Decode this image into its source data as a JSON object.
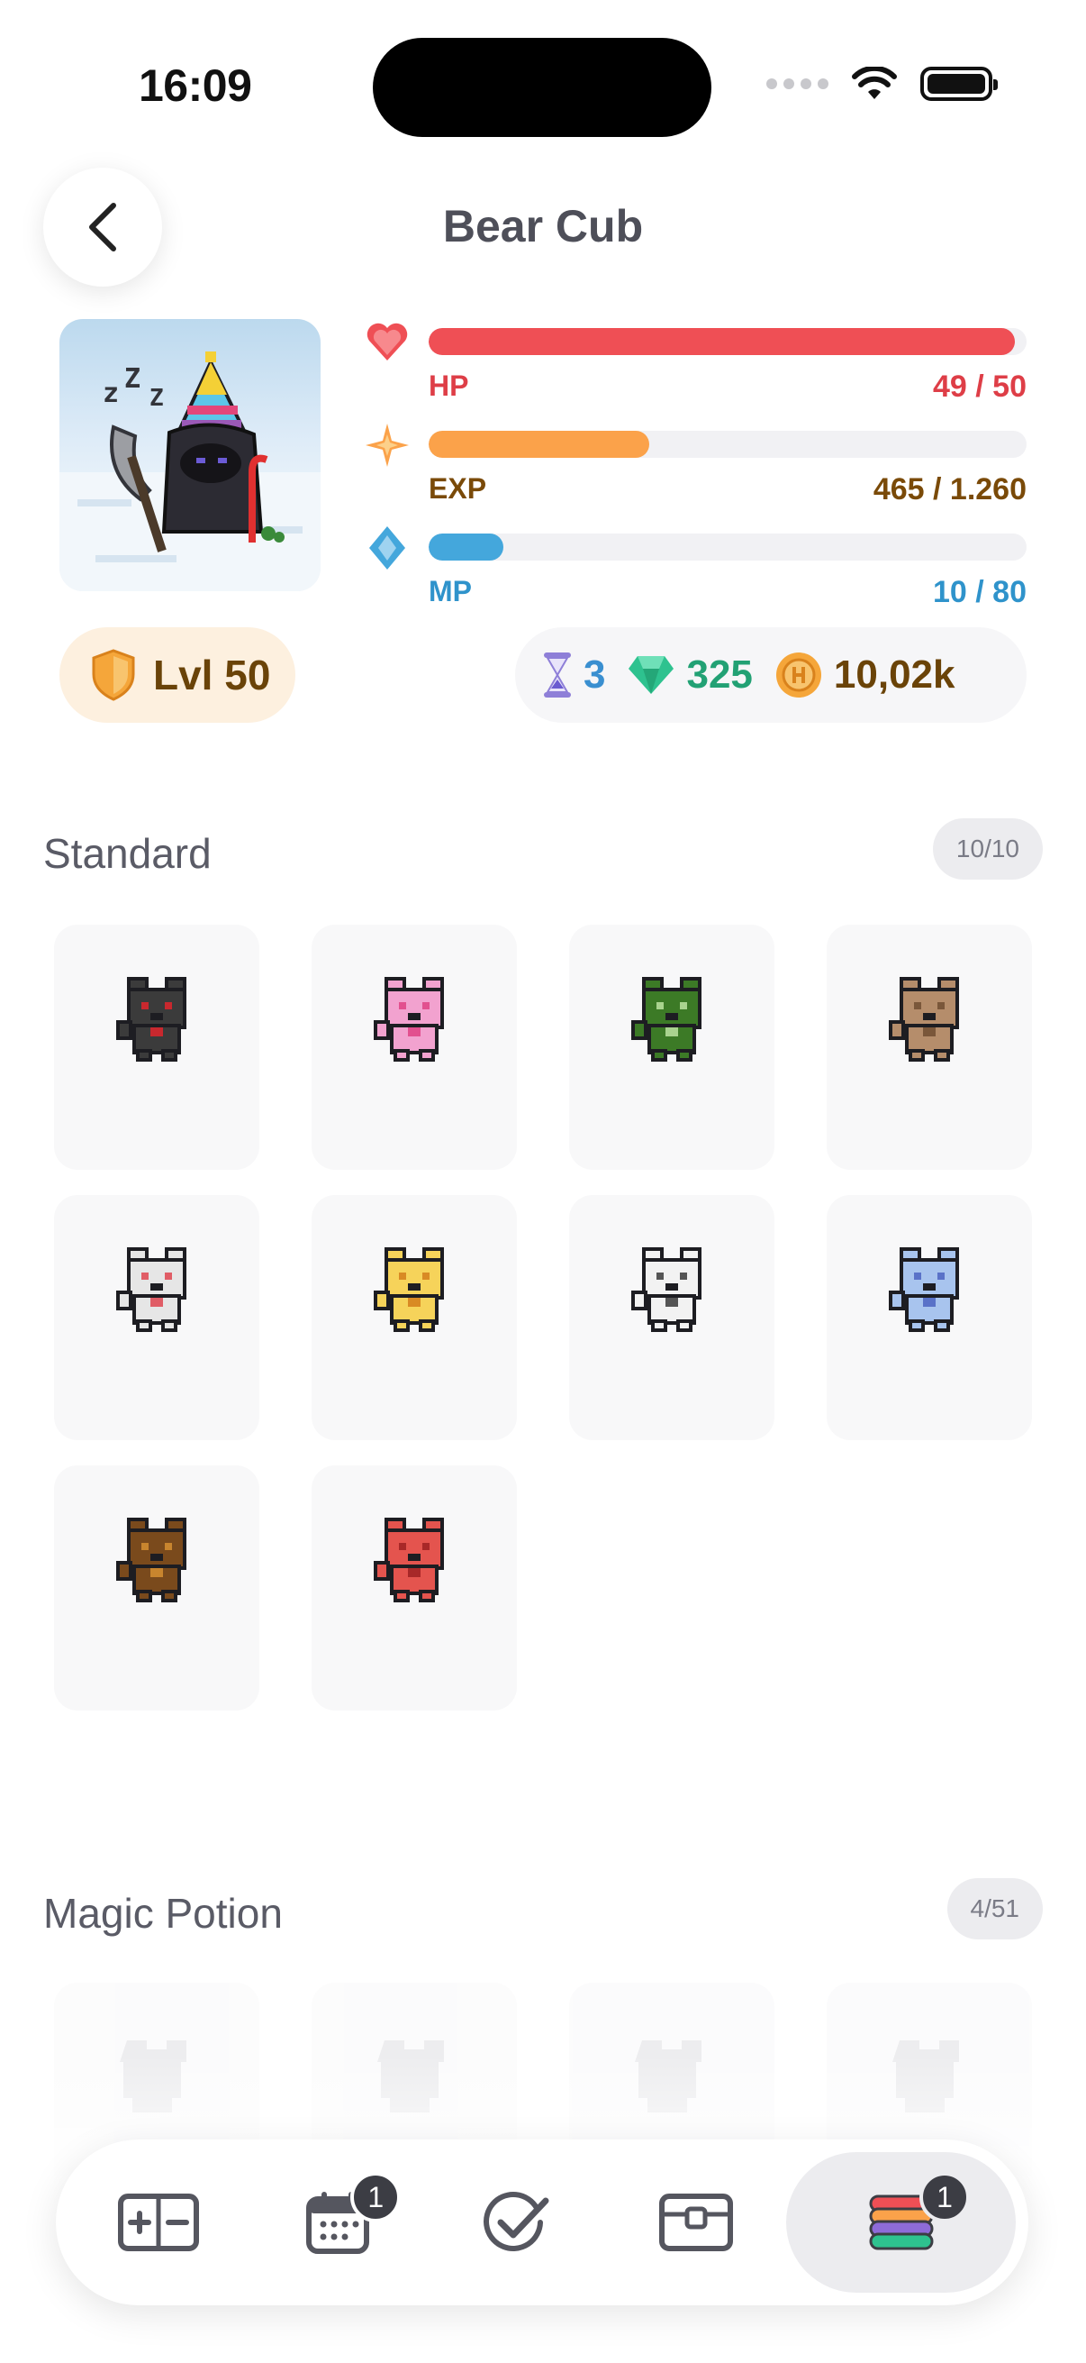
{
  "status": {
    "time": "16:09"
  },
  "header": {
    "title": "Bear Cub"
  },
  "stats": {
    "hp": {
      "label": "HP",
      "value": "49 / 50",
      "fill": 0.98,
      "color": "#ef4f55",
      "text_color": "#de3e47"
    },
    "exp": {
      "label": "EXP",
      "value": "465 / 1.260",
      "fill": 0.369,
      "color": "#fba24a",
      "text_color": "#7a4a08"
    },
    "mp": {
      "label": "MP",
      "value": "10 / 80",
      "fill": 0.125,
      "color": "#44a7dc",
      "text_color": "#2f93cb"
    }
  },
  "level": {
    "label": "Lvl 50"
  },
  "currency": {
    "hourglass": "3",
    "gems": "325",
    "gold": "10,02k",
    "gem_color": "#22a174",
    "hourglass_color": "#3a8fd0",
    "gold_color": "#6a4308"
  },
  "sections": {
    "standard": {
      "title": "Standard",
      "badge": "10/10",
      "pets": [
        {
          "name": "black-bear-cub",
          "color": "#3b3b3b",
          "accent": "#c8282e"
        },
        {
          "name": "pink-bear-cub",
          "color": "#f2a2cf",
          "accent": "#e2508f"
        },
        {
          "name": "green-bear-cub",
          "color": "#3c7a26",
          "accent": "#a9d38e"
        },
        {
          "name": "brown-bear-cub",
          "color": "#b58d6b",
          "accent": "#7a573a"
        },
        {
          "name": "white-bear-cub",
          "color": "#e6e6e6",
          "accent": "#e05d66"
        },
        {
          "name": "golden-bear-cub",
          "color": "#f6d35a",
          "accent": "#d98a24"
        },
        {
          "name": "skeleton-bear-cub",
          "color": "#f2f2f2",
          "accent": "#555555"
        },
        {
          "name": "blue-bear-cub",
          "color": "#a8c4ee",
          "accent": "#5a72c8"
        },
        {
          "name": "dark-brown-bear-cub",
          "color": "#7a4a1c",
          "accent": "#c8852e"
        },
        {
          "name": "red-bear-cub",
          "color": "#e4544e",
          "accent": "#a82828"
        }
      ]
    },
    "magic": {
      "title": "Magic Potion",
      "badge": "4/51"
    }
  },
  "nav": {
    "items": [
      {
        "name": "nav-habits",
        "icon": "add-subtract-icon",
        "badge": ""
      },
      {
        "name": "nav-dailies",
        "icon": "calendar-icon",
        "badge": "1"
      },
      {
        "name": "nav-todos",
        "icon": "check-circle-icon",
        "badge": ""
      },
      {
        "name": "nav-rewards",
        "icon": "chest-icon",
        "badge": ""
      },
      {
        "name": "nav-inventory",
        "icon": "stacked-layers-icon",
        "badge": "1"
      }
    ]
  }
}
